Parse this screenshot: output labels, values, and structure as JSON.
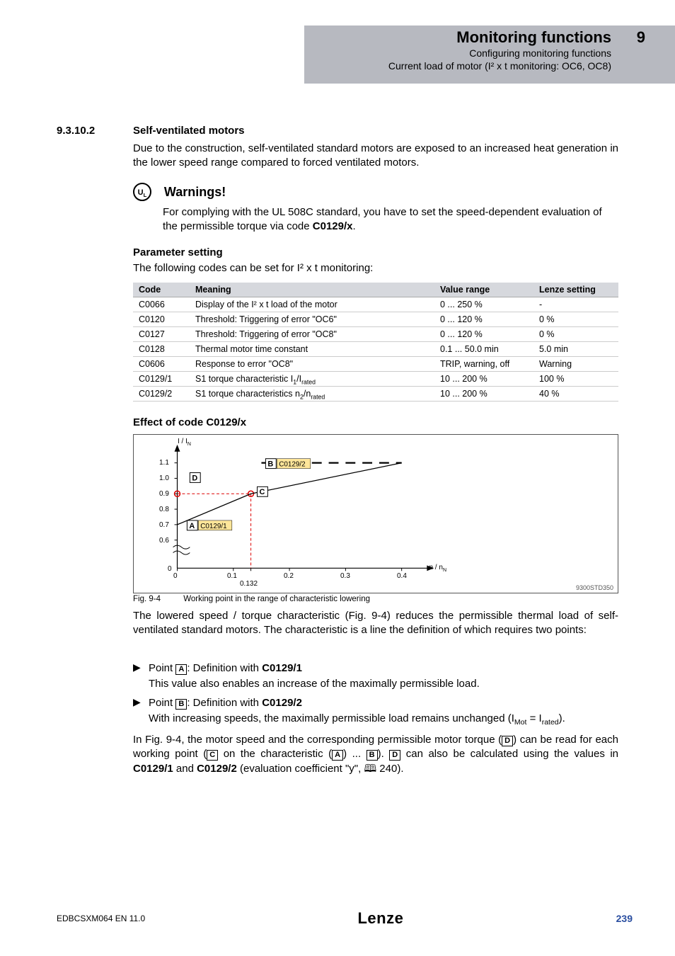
{
  "chapter_number": "9",
  "header": {
    "title": "Monitoring functions",
    "sub1": "Configuring monitoring functions",
    "sub2": "Current load of motor (I² x t monitoring: OC6, OC8)"
  },
  "section": {
    "num": "9.3.10.2",
    "title": "Self-ventilated motors",
    "intro": "Due to the construction, self-ventilated standard motors are exposed to an increased heat generation in the lower speed range compared to forced ventilated motors."
  },
  "warnings": {
    "symbol": "UL",
    "title": "Warnings!",
    "text_a": "For complying with the UL 508C standard, you have to set the speed-dependent evaluation of the permissible torque via code ",
    "text_bold": "C0129/x",
    "text_b": "."
  },
  "param_setting": {
    "heading": "Parameter setting",
    "intro": "The following codes can be set for I² x t monitoring:",
    "headers": {
      "c0": "Code",
      "c1": "Meaning",
      "c2": "Value range",
      "c3": "Lenze setting"
    },
    "rows": [
      {
        "code": "C0066",
        "meaning": "Display of the I² x t load of the motor",
        "range": "0 ... 250 %",
        "setting": "-"
      },
      {
        "code": "C0120",
        "meaning": "Threshold: Triggering of error \"OC6\"",
        "range": "0 ... 120 %",
        "setting": "0 %"
      },
      {
        "code": "C0127",
        "meaning": "Threshold: Triggering of error \"OC8\"",
        "range": "0 ... 120 %",
        "setting": "0 %"
      },
      {
        "code": "C0128",
        "meaning": "Thermal motor time constant",
        "range": "0.1 ... 50.0 min",
        "setting": "5.0 min"
      },
      {
        "code": "C0606",
        "meaning": "Response to error \"OC8\"",
        "range": "TRIP, warning, off",
        "setting": "Warning"
      },
      {
        "code": "C0129/1",
        "meaning": "S1 torque characteristic I₁/Irated",
        "range": "10 ... 200 %",
        "setting": "100 %"
      },
      {
        "code": "C0129/2",
        "meaning": "S1 torque characteristics n₂/nrated",
        "range": "10 ... 200 %",
        "setting": "40 %"
      }
    ]
  },
  "effect_heading": "Effect of code C0129/x",
  "chart_data": {
    "type": "line",
    "ylabel": "I / I_N",
    "xlabel": "n / n_N",
    "x_ticks": [
      "0",
      "0.1",
      "0.2",
      "0.3",
      "0.4"
    ],
    "x_extra_tick": "0.132",
    "y_ticks": [
      "0",
      "0.6",
      "0.7",
      "0.8",
      "0.9",
      "1.0",
      "1.1"
    ],
    "series": [
      {
        "name": "characteristic",
        "points": [
          [
            0,
            0.7
          ],
          [
            0.132,
            0.9
          ],
          [
            0.4,
            1.1
          ]
        ],
        "style": "solid"
      },
      {
        "name": "plateau",
        "points": [
          [
            0.15,
            1.1
          ],
          [
            0.4,
            1.1
          ]
        ],
        "style": "dashed"
      }
    ],
    "markers": {
      "A": {
        "x": 0.02,
        "y": 0.7,
        "label": "C0129/1"
      },
      "B": {
        "x": 0.15,
        "y": 1.1,
        "label": "C0129/2"
      },
      "C": {
        "x": 0.132,
        "y": 0.9
      },
      "D": {
        "x": 0.04,
        "y": 1.0
      }
    },
    "ref": "9300STD350"
  },
  "fig": {
    "num": "Fig. 9-4",
    "caption": "Working point in the range of characteristic lowering"
  },
  "after_fig": {
    "para": "The lowered speed / torque characteristic (Fig. 9-4) reduces the permissible thermal load of self-ventilated standard motors. The characteristic is a line the definition of which requires two points:",
    "bullet1_pre": "Point ",
    "bullet1_sq": "A",
    "bullet1_mid": ": Definition with ",
    "bullet1_bold": "C0129/1",
    "bullet1_sub": "This value also enables an increase of the maximally permissible load.",
    "bullet2_pre": "Point ",
    "bullet2_sq": "B",
    "bullet2_mid": ": Definition with ",
    "bullet2_bold": "C0129/2",
    "bullet2_sub_a": "With increasing speeds, the maximally permissible load remains unchanged (I",
    "bullet2_sub_b": " = I",
    "bullet2_sub_c": ").",
    "final_a": "In Fig. 9-4, the motor speed and the corresponding permissible motor torque (",
    "final_sqD": "D",
    "final_b": ") can be read for each working point (",
    "final_sqC": "C",
    "final_c": " on the characteristic (",
    "final_sqA": "A",
    "final_d": ") ... ",
    "final_sqB": "B",
    "final_e": "). ",
    "final_sqD2": "D",
    "final_f": " can also be calculated using the values in ",
    "final_bold1": "C0129/1",
    "final_g": " and ",
    "final_bold2": "C0129/2",
    "final_h": " (evaluation coefficient \"y\", 🕮 240)."
  },
  "footer": {
    "doc": "EDBCSXM064  EN  11.0",
    "logo": "Lenze",
    "page": "239"
  }
}
